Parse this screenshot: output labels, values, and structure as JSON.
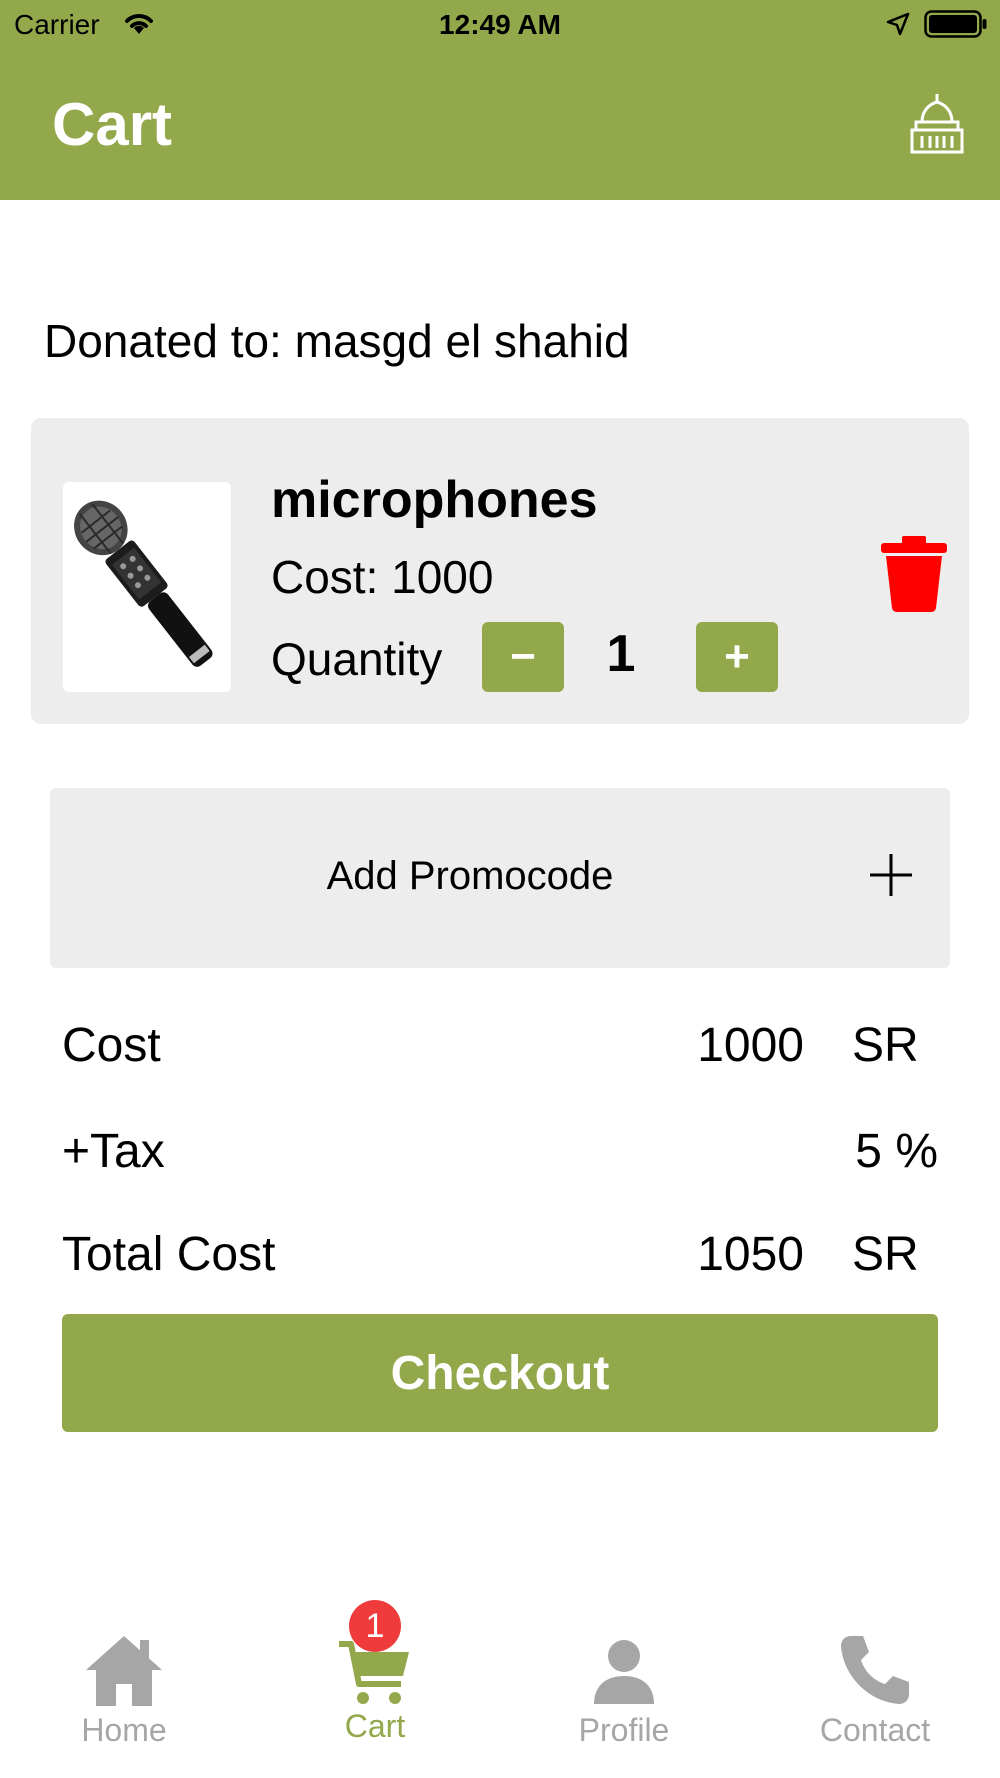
{
  "status_bar": {
    "carrier": "Carrier",
    "time": "12:49 AM"
  },
  "header": {
    "title": "Cart",
    "icon": "mosque-icon"
  },
  "donation": {
    "text": "Donated to: masgd el shahid"
  },
  "cart_items": [
    {
      "name": "microphones",
      "cost_text": "Cost: 1000",
      "quantity_label": "Quantity",
      "quantity": "1",
      "minus_label": "−",
      "plus_label": "+",
      "image": "microphone-image"
    }
  ],
  "promo": {
    "label": "Add Promocode"
  },
  "summary": {
    "cost_label": "Cost",
    "cost_value": "1000",
    "cost_unit": "SR",
    "tax_label": "+Tax",
    "tax_value": "5 %",
    "total_label": "Total Cost",
    "total_value": "1050",
    "total_unit": "SR"
  },
  "checkout_label": "Checkout",
  "tabbar": {
    "items": [
      {
        "label": "Home",
        "icon": "home-icon"
      },
      {
        "label": "Cart",
        "icon": "cart-icon",
        "badge": "1"
      },
      {
        "label": "Profile",
        "icon": "profile-icon"
      },
      {
        "label": "Contact",
        "icon": "phone-icon"
      }
    ]
  },
  "colors": {
    "accent": "#93a84b",
    "card_bg": "#ededed",
    "delete": "#ff0000",
    "badge": "#ef3b3b",
    "inactive_tab": "#a6a6a6"
  }
}
